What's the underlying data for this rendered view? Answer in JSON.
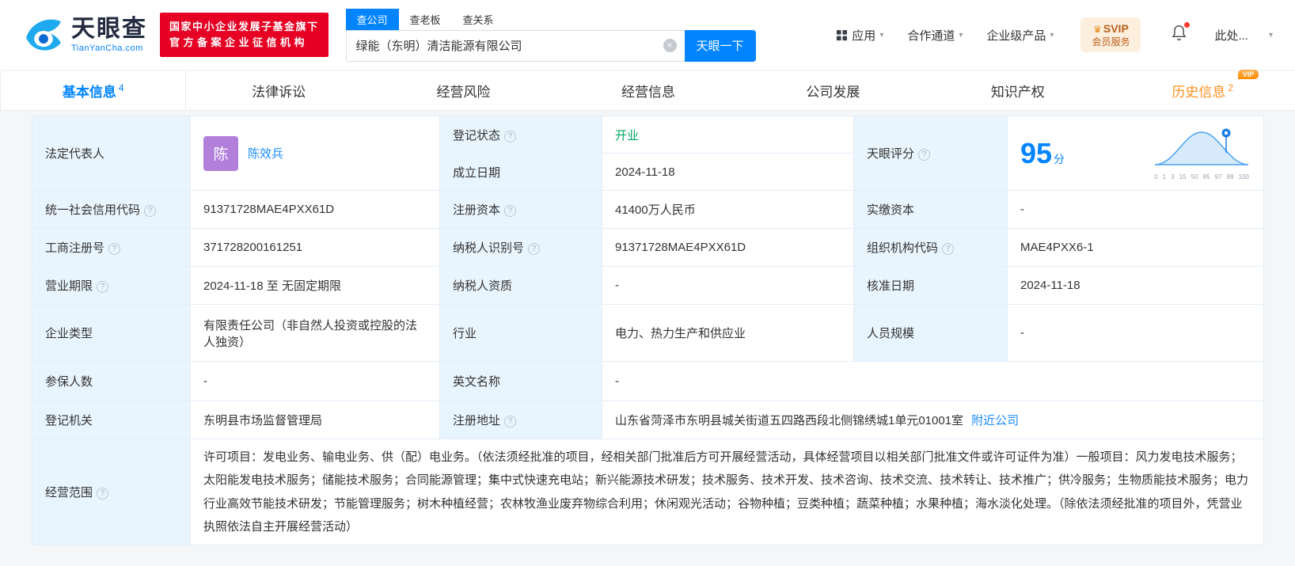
{
  "brand": {
    "logo_cn": "天眼查",
    "logo_en": "TianYanCha.com",
    "gov_badge_line1": "国家中小企业发展子基金旗下",
    "gov_badge_line2": "官方备案企业征信机构"
  },
  "search": {
    "tabs": [
      {
        "label": "查公司"
      },
      {
        "label": "查老板"
      },
      {
        "label": "查关系"
      }
    ],
    "value": "绿能（东明）清洁能源有限公司",
    "clear": "×",
    "button": "天眼一下"
  },
  "nav": {
    "apps": "应用",
    "cooperation": "合作通道",
    "enterprise": "企业级产品",
    "svip_line1": "SVIP",
    "svip_line2": "会员服务",
    "user": "此处...",
    "caret": "▾"
  },
  "tabs": [
    {
      "label": "基本信息",
      "badge": "4"
    },
    {
      "label": "法律诉讼"
    },
    {
      "label": "经营风险"
    },
    {
      "label": "经营信息"
    },
    {
      "label": "公司发展"
    },
    {
      "label": "知识产权"
    },
    {
      "label": "历史信息",
      "badge": "2",
      "tag": "VIP"
    }
  ],
  "score": {
    "label": "天眼评分",
    "value": "95",
    "unit": "分",
    "axis": [
      "0",
      "1",
      "3",
      "15",
      "50",
      "85",
      "97",
      "99",
      "100"
    ]
  },
  "info": {
    "legal_rep": {
      "label": "法定代表人",
      "avatar": "陈",
      "name": "陈效兵"
    },
    "reg_status": {
      "label": "登记状态",
      "value": "开业"
    },
    "establish_date": {
      "label": "成立日期",
      "value": "2024-11-18"
    },
    "credit_code": {
      "label": "统一社会信用代码",
      "value": "91371728MAE4PXX61D"
    },
    "reg_capital": {
      "label": "注册资本",
      "value": "41400万人民币"
    },
    "paid_capital": {
      "label": "实缴资本",
      "value": "-"
    },
    "reg_number": {
      "label": "工商注册号",
      "value": "371728200161251"
    },
    "taxpayer_id": {
      "label": "纳税人识别号",
      "value": "91371728MAE4PXX61D"
    },
    "org_code": {
      "label": "组织机构代码",
      "value": "MAE4PXX6-1"
    },
    "business_term": {
      "label": "营业期限",
      "value": "2024-11-18 至 无固定期限"
    },
    "taxpayer_qualification": {
      "label": "纳税人资质",
      "value": "-"
    },
    "approval_date": {
      "label": "核准日期",
      "value": "2024-11-18"
    },
    "company_type": {
      "label": "企业类型",
      "value": "有限责任公司（非自然人投资或控股的法人独资）"
    },
    "industry": {
      "label": "行业",
      "value": "电力、热力生产和供应业"
    },
    "staff_size": {
      "label": "人员规模",
      "value": "-"
    },
    "insured_count": {
      "label": "参保人数",
      "value": "-"
    },
    "english_name": {
      "label": "英文名称",
      "value": "-"
    },
    "reg_authority": {
      "label": "登记机关",
      "value": "东明县市场监督管理局"
    },
    "reg_address": {
      "label": "注册地址",
      "value": "山东省菏泽市东明县城关街道五四路西段北侧锦绣城1单元01001室",
      "link": "附近公司"
    },
    "business_scope": {
      "label": "经营范围",
      "value": "许可项目：发电业务、输电业务、供（配）电业务。（依法须经批准的项目，经相关部门批准后方可开展经营活动，具体经营项目以相关部门批准文件或许可证件为准）一般项目：风力发电技术服务；太阳能发电技术服务；储能技术服务；合同能源管理；集中式快速充电站；新兴能源技术研发；技术服务、技术开发、技术咨询、技术交流、技术转让、技术推广；供冷服务；生物质能技术服务；电力行业高效节能技术研发；节能管理服务；树木种植经营；农林牧渔业废弃物综合利用；休闲观光活动；谷物种植；豆类种植；蔬菜种植；水果种植；海水淡化处理。（除依法须经批准的项目外，凭营业执照依法自主开展经营活动）"
    }
  },
  "colors": {
    "primary_blue": "#0084ff",
    "brand_red": "#e60023",
    "open_green": "#00a862",
    "history_orange": "#ff9022",
    "label_bg": "#e9f5fe"
  }
}
